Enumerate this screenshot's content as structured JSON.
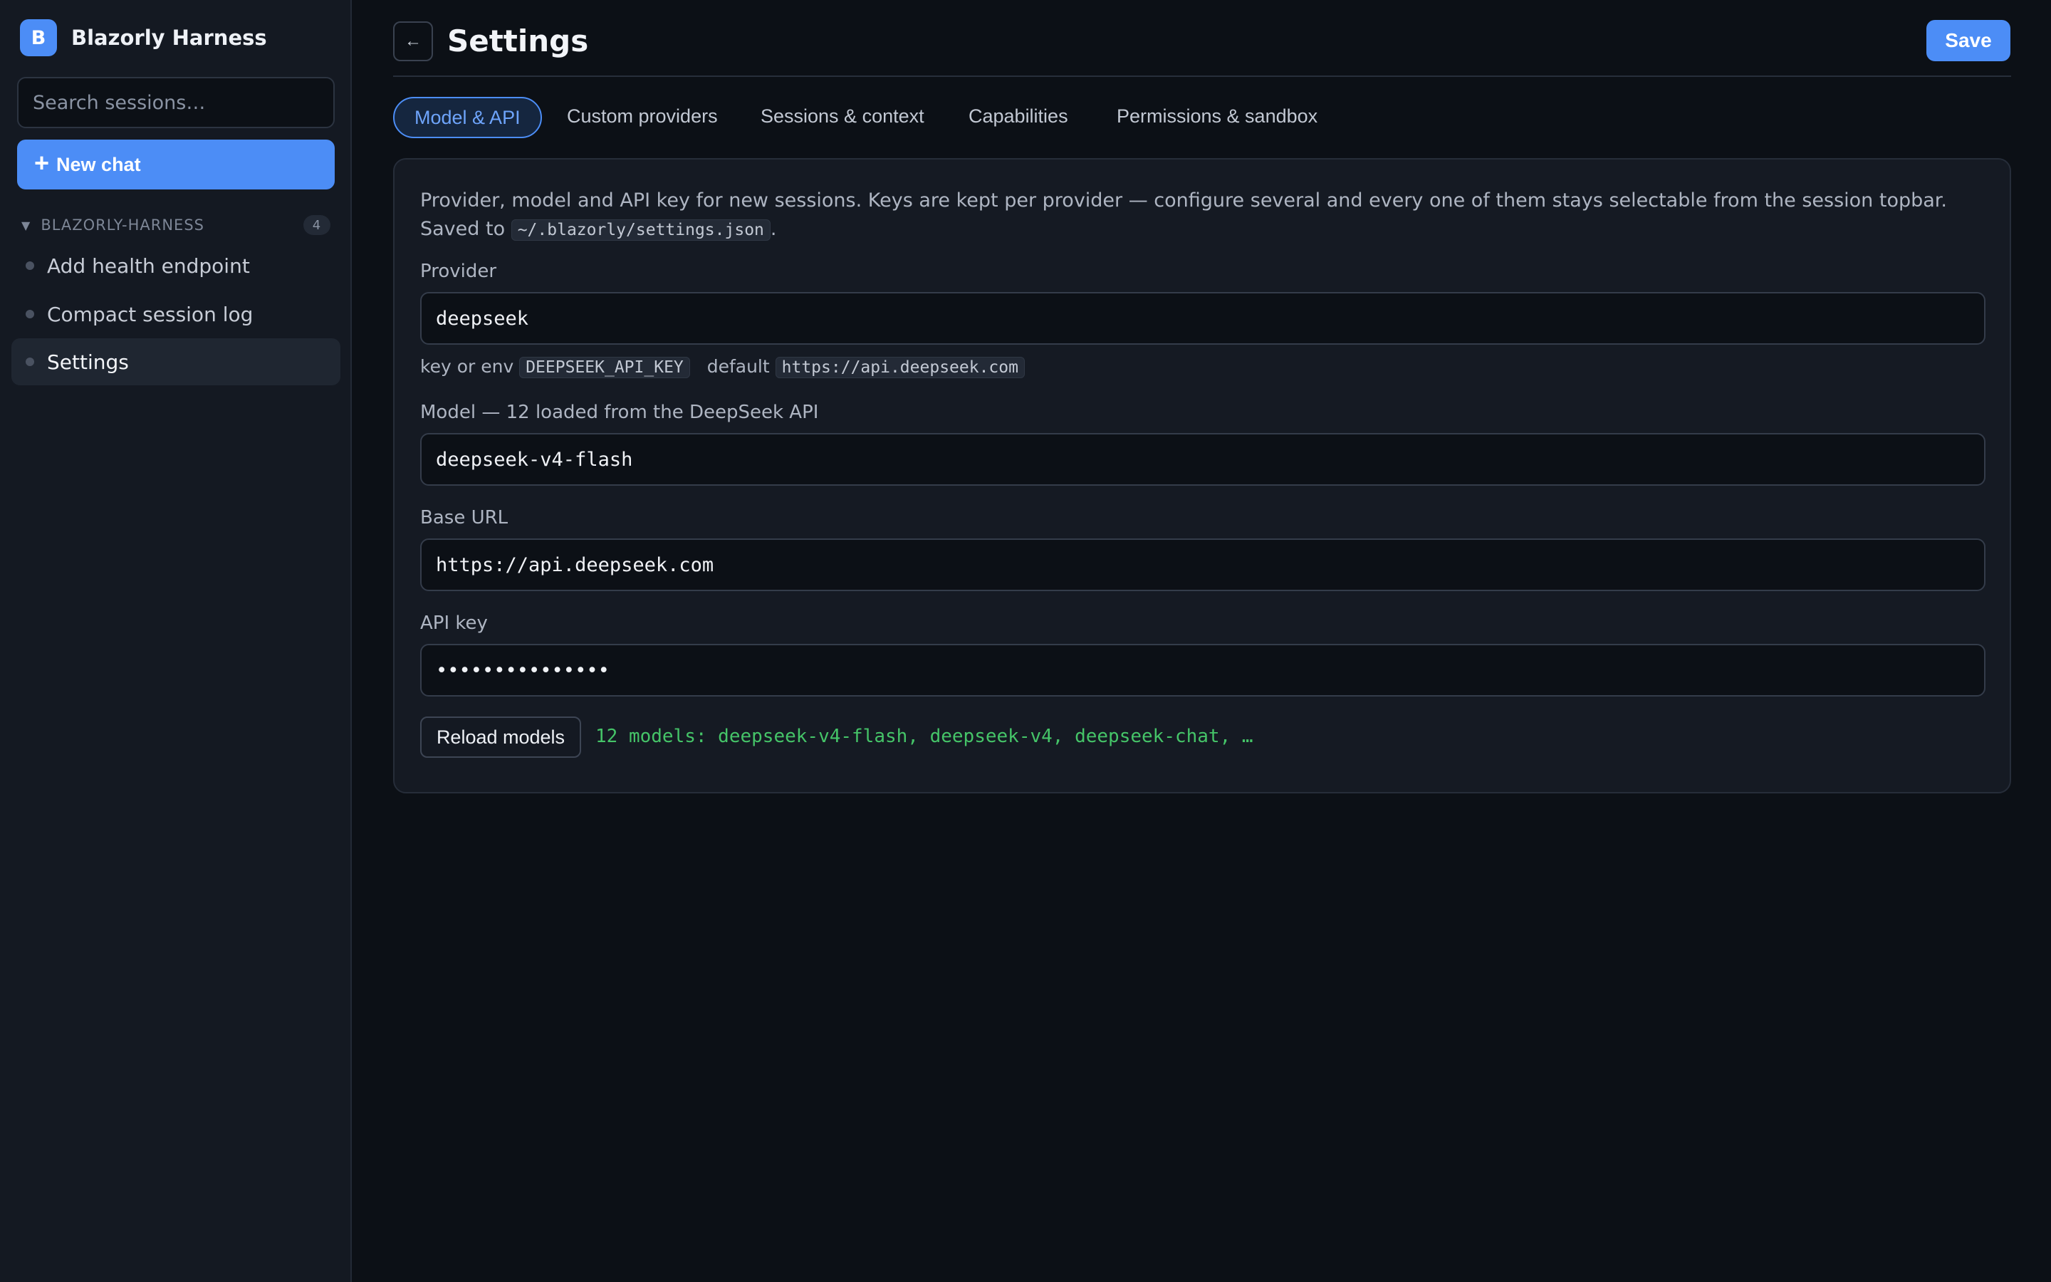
{
  "sidebar": {
    "brand": {
      "logo_letter": "B",
      "name": "Blazorly Harness",
      "accent": "#4c8df6"
    },
    "search": {
      "placeholder": "Search sessions…",
      "value": ""
    },
    "new_chat": {
      "icon": "plus-icon",
      "label": "New chat"
    },
    "group": {
      "name": "BLAZORLY-HARNESS",
      "count": "4"
    },
    "sessions": [
      {
        "label": "Add health endpoint",
        "active": false
      },
      {
        "label": "Compact session log",
        "active": false
      },
      {
        "label": "Settings",
        "active": true
      }
    ]
  },
  "header": {
    "back_icon": "←",
    "title": "Settings",
    "save_label": "Save"
  },
  "tabs": [
    {
      "label": "Model & API",
      "active": true
    },
    {
      "label": "Custom providers",
      "active": false
    },
    {
      "label": "Sessions & context",
      "active": false
    },
    {
      "label": "Capabilities",
      "active": false
    },
    {
      "label": "Permissions & sandbox",
      "active": false
    }
  ],
  "panel": {
    "description": "Provider, model and API key for new sessions. Keys are kept per provider — configure several and every one of them stays selectable from the session topbar. Saved to",
    "settings_path": "~/.blazorly/settings.json",
    "description_end": ".",
    "provider": {
      "label": "Provider",
      "value": "deepseek"
    },
    "hint": {
      "prefix": "key or env",
      "env_var": "DEEPSEEK_API_KEY",
      "default_label": "default",
      "default_url": "https://api.deepseek.com"
    },
    "model": {
      "label": "Model — 12 loaded from the DeepSeek API",
      "value": "deepseek-v4-flash"
    },
    "base_url": {
      "label": "Base URL",
      "value": "https://api.deepseek.com"
    },
    "api_key": {
      "label": "API key",
      "value": "•••••••••••••••"
    },
    "reload_label": "Reload models",
    "models_status": "12 models: deepseek-v4-flash, deepseek-v4, deepseek-chat, …",
    "status_color": "#45c468"
  }
}
